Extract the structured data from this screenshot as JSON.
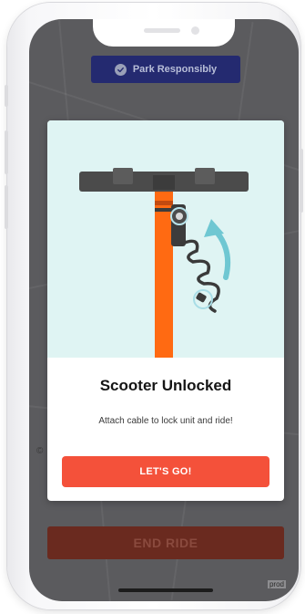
{
  "banner": {
    "label": "Park Responsibly",
    "icon": "check-circle-icon"
  },
  "modal": {
    "illustration_icon": "scooter-cable-lock-illustration",
    "title": "Scooter Unlocked",
    "subtitle": "Attach cable to lock unit and ride!",
    "button_label": "LET'S GO!"
  },
  "background_ui": {
    "end_ride_label": "END RIDE",
    "env_label": "prod",
    "copyright_symbol": "©"
  },
  "colors": {
    "banner_bg": "#242a70",
    "illustration_bg": "#dff4f3",
    "accent_button": "#f4513a",
    "scooter_stem": "#ff6a12",
    "end_ride_dimmed": "#6a2a1f"
  }
}
